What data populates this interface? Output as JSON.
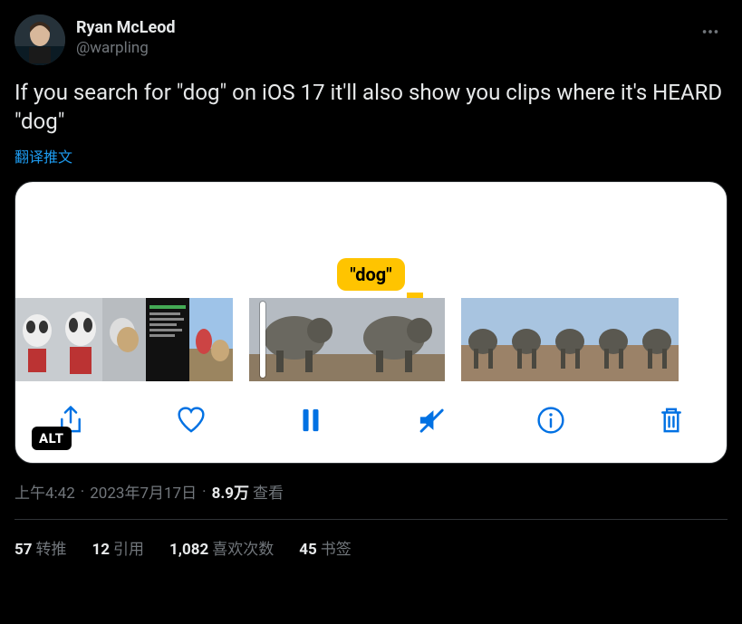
{
  "author": {
    "display_name": "Ryan McLeod",
    "handle": "@warpling"
  },
  "tweet_text": "If you search for \"dog\" on iOS 17 it'll also show you clips where it's HEARD \"dog\"",
  "translate_label": "翻译推文",
  "media": {
    "highlight_label": "\"dog\"",
    "alt_badge": "ALT"
  },
  "meta": {
    "time": "上午4:42",
    "date": "2023年7月17日",
    "views_count": "8.9万",
    "views_label": "查看"
  },
  "stats": {
    "retweets_count": "57",
    "retweets_label": "转推",
    "quotes_count": "12",
    "quotes_label": "引用",
    "likes_count": "1,082",
    "likes_label": "喜欢次数",
    "bookmarks_count": "45",
    "bookmarks_label": "书签"
  }
}
